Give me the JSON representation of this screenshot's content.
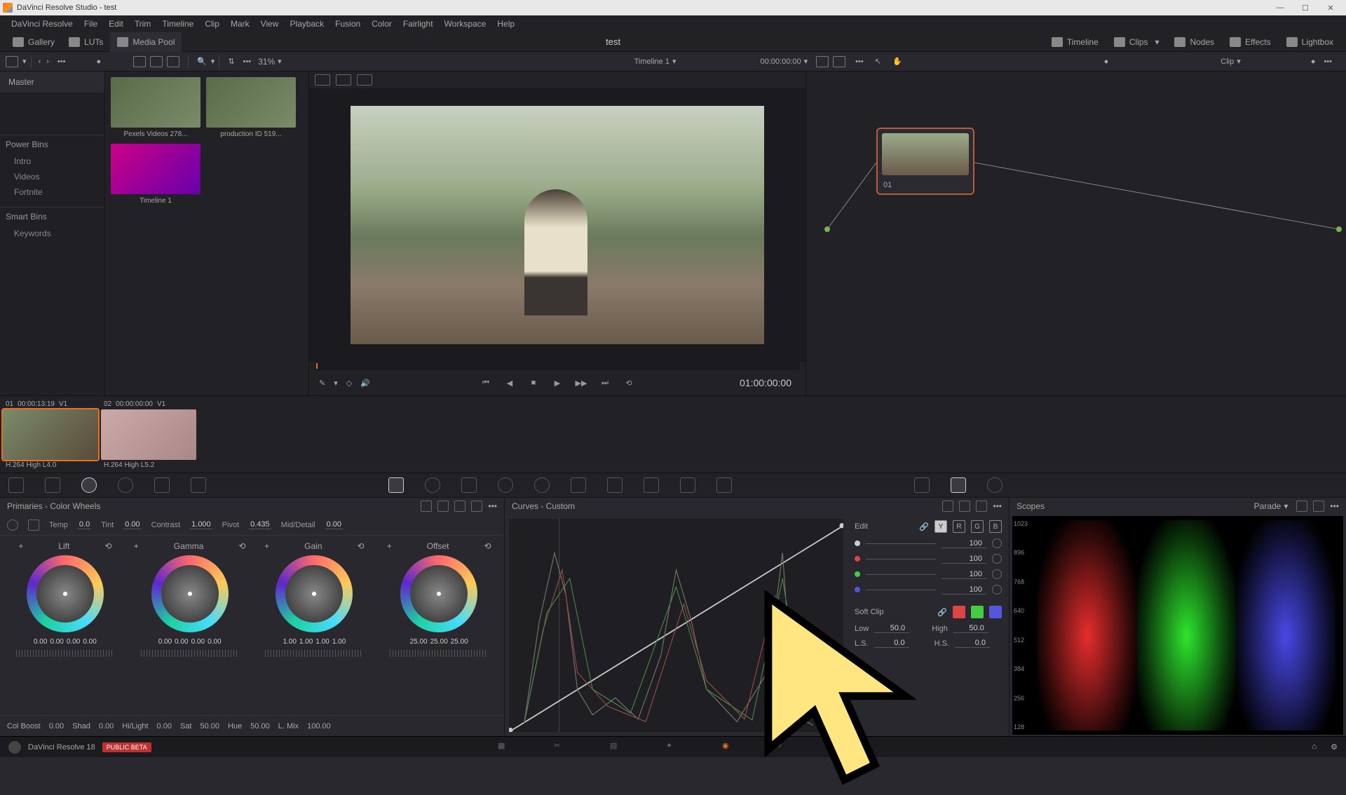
{
  "window": {
    "title": "DaVinci Resolve Studio - test"
  },
  "menu": [
    "DaVinci Resolve",
    "File",
    "Edit",
    "Trim",
    "Timeline",
    "Clip",
    "Mark",
    "View",
    "Playback",
    "Fusion",
    "Color",
    "Fairlight",
    "Workspace",
    "Help"
  ],
  "toolbar": {
    "gallery": "Gallery",
    "luts": "LUTs",
    "mediapool": "Media Pool",
    "project": "test",
    "timeline": "Timeline",
    "clips": "Clips",
    "nodes": "Nodes",
    "effects": "Effects",
    "lightbox": "Lightbox"
  },
  "subbar": {
    "zoom": "31%",
    "timeline_name": "Timeline 1",
    "timecode": "00:00:00:00",
    "clip_label": "Clip"
  },
  "sidebar": {
    "master": "Master",
    "power_bins": {
      "header": "Power Bins",
      "items": [
        "Intro",
        "Videos",
        "Fortnite"
      ]
    },
    "smart_bins": {
      "header": "Smart Bins",
      "items": [
        "Keywords"
      ]
    }
  },
  "thumbs": [
    {
      "label": "Pexels Videos 278..."
    },
    {
      "label": "production ID 519..."
    },
    {
      "label": "Timeline 1",
      "pink": true
    }
  ],
  "viewer": {
    "tc": "01:00:00:00"
  },
  "node": {
    "label": "01"
  },
  "clips": [
    {
      "num": "01",
      "tc": "00:00:13:19",
      "track": "V1",
      "codec": "H.264 High L4.0",
      "sel": true
    },
    {
      "num": "02",
      "tc": "00:00:00:00",
      "track": "V1",
      "codec": "H.264 High L5.2",
      "sel": false
    }
  ],
  "wheels": {
    "title": "Primaries - Color Wheels",
    "temp": {
      "l": "Temp",
      "v": "0.0"
    },
    "tint": {
      "l": "Tint",
      "v": "0.00"
    },
    "contrast": {
      "l": "Contrast",
      "v": "1.000"
    },
    "pivot": {
      "l": "Pivot",
      "v": "0.435"
    },
    "mid": {
      "l": "Mid/Detail",
      "v": "0.00"
    },
    "cols": [
      {
        "name": "Lift",
        "vals": [
          "0.00",
          "0.00",
          "0.00",
          "0.00"
        ]
      },
      {
        "name": "Gamma",
        "vals": [
          "0.00",
          "0.00",
          "0.00",
          "0.00"
        ]
      },
      {
        "name": "Gain",
        "vals": [
          "1.00",
          "1.00",
          "1.00",
          "1.00"
        ]
      },
      {
        "name": "Offset",
        "vals": [
          "25.00",
          "25.00",
          "25.00"
        ]
      }
    ],
    "adj": {
      "colboost": {
        "l": "Col Boost",
        "v": "0.00"
      },
      "shad": {
        "l": "Shad",
        "v": "0.00"
      },
      "hilight": {
        "l": "Hi/Light",
        "v": "0.00"
      },
      "sat": {
        "l": "Sat",
        "v": "50.00"
      },
      "hue": {
        "l": "Hue",
        "v": "50.00"
      },
      "lmix": {
        "l": "L. Mix",
        "v": "100.00"
      }
    }
  },
  "curves": {
    "title": "Curves - Custom",
    "edit": "Edit",
    "channels": [
      "Y",
      "R",
      "G",
      "B"
    ],
    "intensity": [
      "100",
      "100",
      "100",
      "100"
    ],
    "softclip": "Soft Clip",
    "low": {
      "l": "Low",
      "v": "50.0"
    },
    "high": {
      "l": "High",
      "v": "50.0"
    },
    "ls": {
      "l": "L.S.",
      "v": "0.0"
    },
    "hs": {
      "l": "H.S.",
      "v": "0.0"
    }
  },
  "scopes": {
    "title": "Scopes",
    "mode": "Parade",
    "ticks": [
      "1023",
      "896",
      "768",
      "640",
      "512",
      "384",
      "256",
      "128"
    ]
  },
  "pagebar": {
    "app": "DaVinci Resolve 18",
    "badge": "PUBLIC BETA"
  }
}
